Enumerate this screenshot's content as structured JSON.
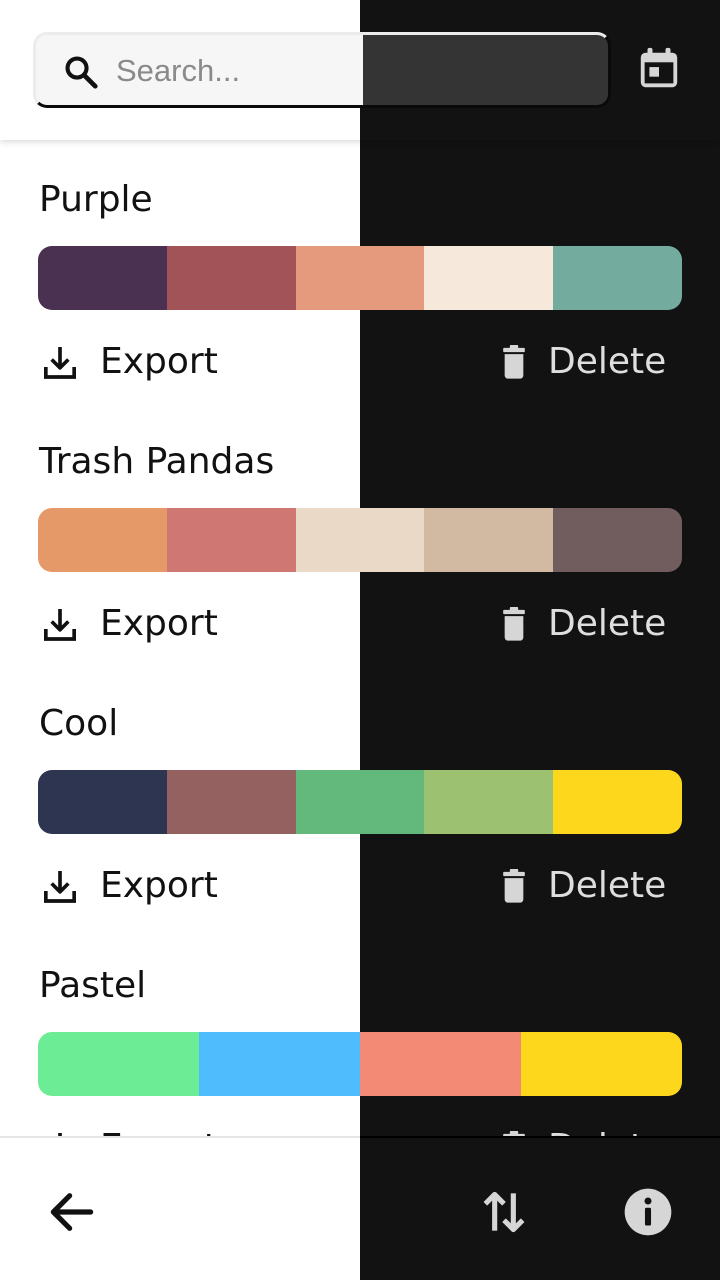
{
  "search": {
    "placeholder": "Search..."
  },
  "icons": {
    "search": "search-icon",
    "calendar": "calendar-icon",
    "export": "download-icon",
    "delete": "trash-icon",
    "back": "arrow-left-icon",
    "sort": "swap-vertical-icon",
    "info": "info-icon"
  },
  "palettes": [
    {
      "name": "Purple",
      "export_label": "Export",
      "delete_label": "Delete",
      "colors": [
        "#4a3051",
        "#a15358",
        "#e59a7d",
        "#f6e9dc",
        "#73ac9e"
      ]
    },
    {
      "name": "Trash Pandas",
      "export_label": "Export",
      "delete_label": "Delete",
      "colors": [
        "#e59868",
        "#cf7773",
        "#e9d9c6",
        "#d2b9a1",
        "#715d5e"
      ]
    },
    {
      "name": "Cool",
      "export_label": "Export",
      "delete_label": "Delete",
      "colors": [
        "#2e3550",
        "#946160",
        "#63b87b",
        "#9cc271",
        "#fdd71b"
      ]
    },
    {
      "name": "Pastel",
      "export_label": "Export",
      "delete_label": "Delete",
      "colors": [
        "#6ced95",
        "#4fbdfd",
        "#f28a76",
        "#fdd71b"
      ]
    }
  ]
}
